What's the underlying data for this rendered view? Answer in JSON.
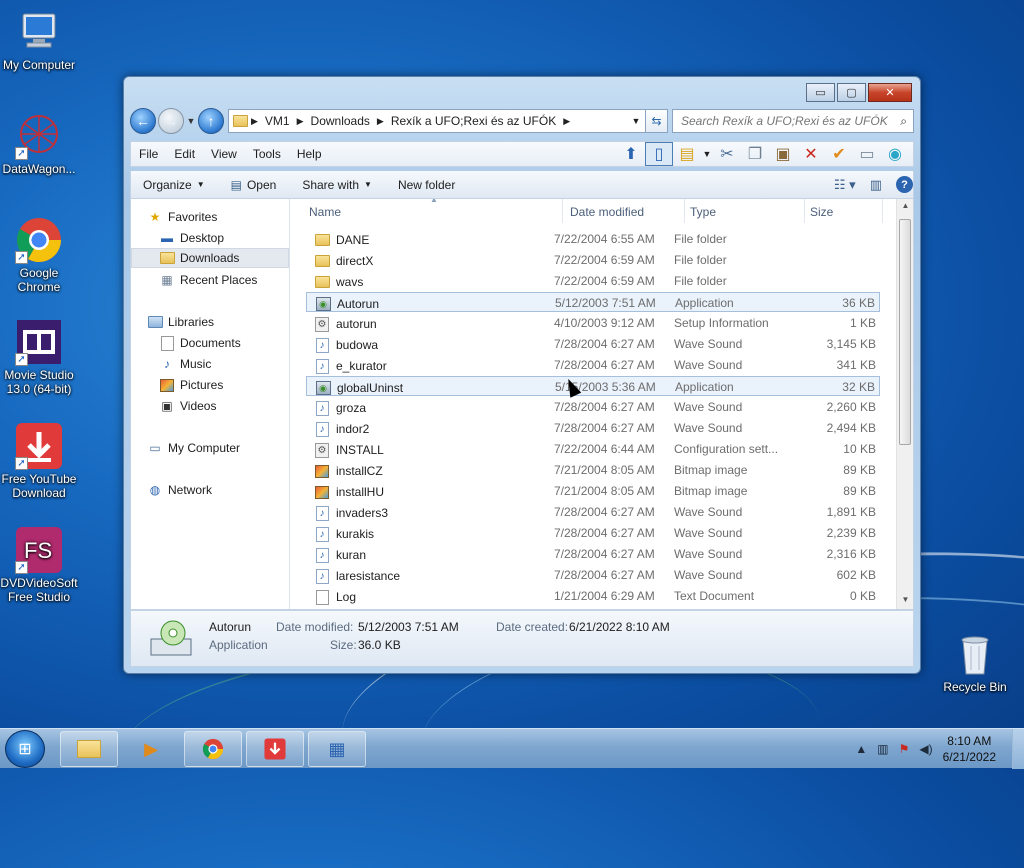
{
  "desktop": {
    "icons": [
      {
        "label": "My Computer",
        "icon": "computer-icon"
      },
      {
        "label": "DataWagon...",
        "icon": "network-ball-icon"
      },
      {
        "label": "Google Chrome",
        "icon": "chrome-icon"
      },
      {
        "label": "Movie Studio 13.0 (64-bit)",
        "icon": "film-icon"
      },
      {
        "label": "Free YouTube Download",
        "icon": "download-icon"
      },
      {
        "label": "DVDVideoSoft Free Studio",
        "icon": "fs-icon"
      },
      {
        "label": "Recycle Bin",
        "icon": "recycle-bin-icon"
      }
    ]
  },
  "window": {
    "controls": {
      "minimize": "▭",
      "maximize": "▢",
      "close": "✕"
    },
    "address": {
      "crumbs": [
        "VM1",
        "Downloads",
        "Rexík a UFO;Rexi és az UFÓK"
      ]
    },
    "search": {
      "placeholder": "Search Rexík a UFO;Rexi és az UFÓK"
    },
    "menu": [
      "File",
      "Edit",
      "View",
      "Tools",
      "Help"
    ],
    "commands": {
      "organize": "Organize",
      "open": "Open",
      "share_with": "Share with",
      "new_folder": "New folder"
    },
    "nav_pane": {
      "favorites": "Favorites",
      "favorites_items": [
        "Desktop",
        "Downloads",
        "Recent Places"
      ],
      "libraries": "Libraries",
      "libraries_items": [
        "Documents",
        "Music",
        "Pictures",
        "Videos"
      ],
      "my_computer": "My Computer",
      "network": "Network"
    },
    "columns": {
      "name": "Name",
      "date": "Date modified",
      "type": "Type",
      "size": "Size"
    },
    "files": [
      {
        "name": "DANE",
        "date": "7/22/2004 6:55 AM",
        "type": "File folder",
        "size": "",
        "icon": "folder-icon"
      },
      {
        "name": "directX",
        "date": "7/22/2004 6:59 AM",
        "type": "File folder",
        "size": "",
        "icon": "folder-icon"
      },
      {
        "name": "wavs",
        "date": "7/22/2004 6:59 AM",
        "type": "File folder",
        "size": "",
        "icon": "folder-icon"
      },
      {
        "name": "Autorun",
        "date": "5/12/2003 7:51 AM",
        "type": "Application",
        "size": "36 KB",
        "icon": "application-icon"
      },
      {
        "name": "autorun",
        "date": "4/10/2003 9:12 AM",
        "type": "Setup Information",
        "size": "1 KB",
        "icon": "setup-info-icon"
      },
      {
        "name": "budowa",
        "date": "7/28/2004 6:27 AM",
        "type": "Wave Sound",
        "size": "3,145 KB",
        "icon": "wave-sound-icon"
      },
      {
        "name": "e_kurator",
        "date": "7/28/2004 6:27 AM",
        "type": "Wave Sound",
        "size": "341 KB",
        "icon": "wave-sound-icon"
      },
      {
        "name": "globalUninst",
        "date": "5/15/2003 5:36 AM",
        "type": "Application",
        "size": "32 KB",
        "icon": "application-icon"
      },
      {
        "name": "groza",
        "date": "7/28/2004 6:27 AM",
        "type": "Wave Sound",
        "size": "2,260 KB",
        "icon": "wave-sound-icon"
      },
      {
        "name": "indor2",
        "date": "7/28/2004 6:27 AM",
        "type": "Wave Sound",
        "size": "2,494 KB",
        "icon": "wave-sound-icon"
      },
      {
        "name": "INSTALL",
        "date": "7/22/2004 6:44 AM",
        "type": "Configuration sett...",
        "size": "10 KB",
        "icon": "config-icon"
      },
      {
        "name": "installCZ",
        "date": "7/21/2004 8:05 AM",
        "type": "Bitmap image",
        "size": "89 KB",
        "icon": "bitmap-icon"
      },
      {
        "name": "installHU",
        "date": "7/21/2004 8:05 AM",
        "type": "Bitmap image",
        "size": "89 KB",
        "icon": "bitmap-icon"
      },
      {
        "name": "invaders3",
        "date": "7/28/2004 6:27 AM",
        "type": "Wave Sound",
        "size": "1,891 KB",
        "icon": "wave-sound-icon"
      },
      {
        "name": "kurakis",
        "date": "7/28/2004 6:27 AM",
        "type": "Wave Sound",
        "size": "2,239 KB",
        "icon": "wave-sound-icon"
      },
      {
        "name": "kuran",
        "date": "7/28/2004 6:27 AM",
        "type": "Wave Sound",
        "size": "2,316 KB",
        "icon": "wave-sound-icon"
      },
      {
        "name": "laresistance",
        "date": "7/28/2004 6:27 AM",
        "type": "Wave Sound",
        "size": "602 KB",
        "icon": "wave-sound-icon"
      },
      {
        "name": "Log",
        "date": "1/21/2004 6:29 AM",
        "type": "Text Document",
        "size": "0 KB",
        "icon": "text-document-icon"
      }
    ],
    "details": {
      "name": "Autorun",
      "type": "Application",
      "date_modified_label": "Date modified:",
      "date_modified": "5/12/2003 7:51 AM",
      "size_label": "Size:",
      "size": "36.0 KB",
      "date_created_label": "Date created:",
      "date_created": "6/21/2022 8:10 AM"
    }
  },
  "taskbar": {
    "clock_time": "8:10 AM",
    "clock_date": "6/21/2022"
  },
  "colors": {
    "selection": "#eaf2fb",
    "accent": "#2b64b0"
  }
}
